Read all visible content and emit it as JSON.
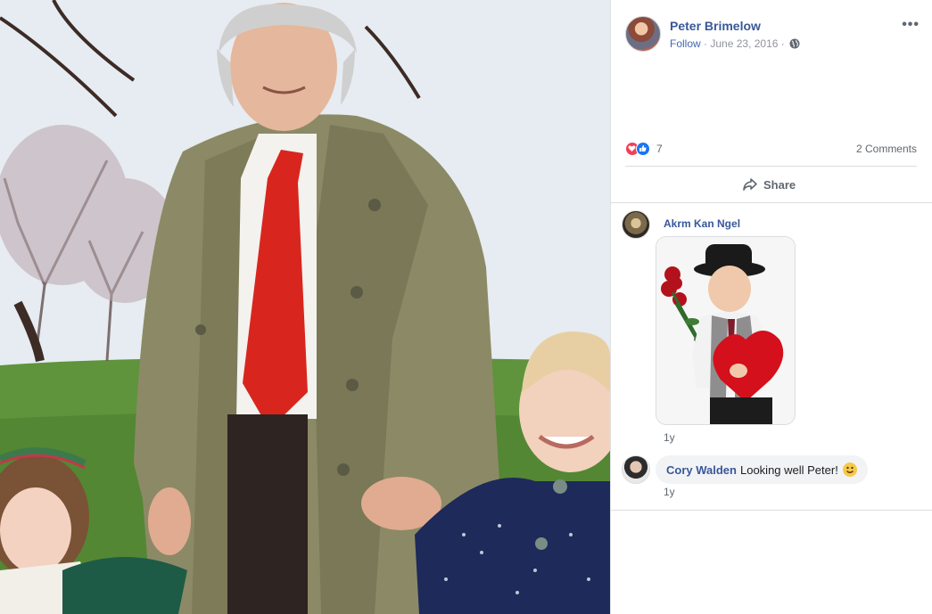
{
  "post": {
    "author": "Peter Brimelow",
    "follow_label": "Follow",
    "separator": "·",
    "date": "June 23, 2016",
    "privacy_icon": "globe-icon",
    "more_label": "•••"
  },
  "reactions": {
    "icons": [
      "love-icon",
      "like-icon"
    ],
    "count": "7",
    "comments_label": "2 Comments"
  },
  "actions": {
    "share_label": "Share",
    "share_icon": "share-arrow-icon"
  },
  "comments": [
    {
      "author": "Akrm Kan Ngel",
      "text": "",
      "attachment": "sticker-image",
      "time": "1y"
    },
    {
      "author": "Cory Walden",
      "text": "Looking well Peter!",
      "emoji": "smiley-emoji",
      "time": "1y"
    }
  ],
  "colors": {
    "link_blue": "#385898",
    "follow_blue": "#4267b2",
    "meta_gray": "#90949c",
    "love_red": "#f33e58",
    "like_blue": "#1877f2",
    "bubble_bg": "#f2f3f5"
  }
}
